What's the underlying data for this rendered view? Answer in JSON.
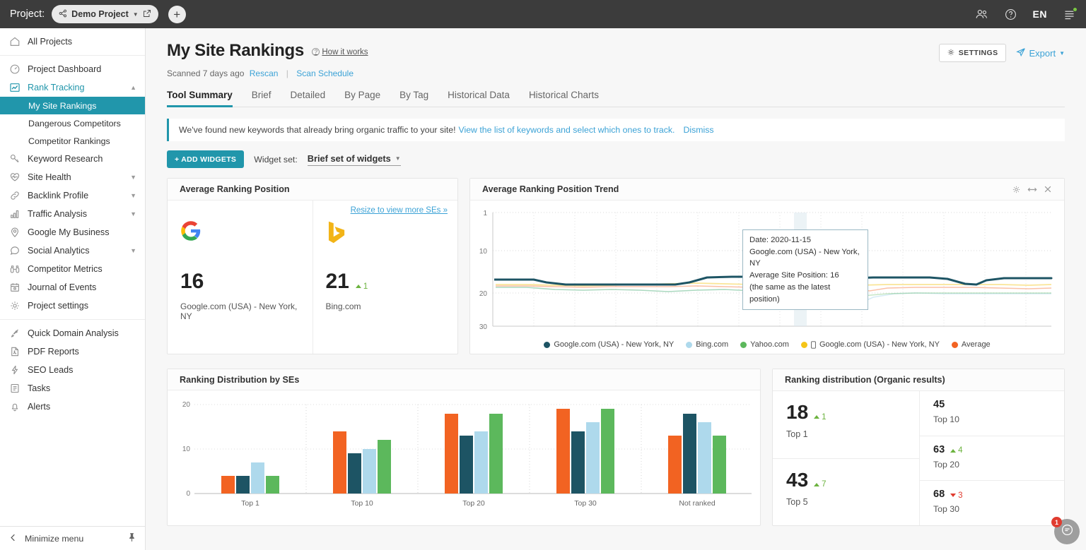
{
  "topbar": {
    "project_label": "Project:",
    "project_name": "Demo Project",
    "add_label": "+",
    "lang": "EN",
    "icons": {
      "users": "users-icon",
      "help": "help-icon",
      "menu": "menu-icon"
    }
  },
  "sidebar": {
    "all_projects": "All Projects",
    "groups": [
      {
        "items": [
          {
            "label": "Project Dashboard",
            "icon": "gauge-icon",
            "chevron": false
          },
          {
            "label": "Rank Tracking",
            "icon": "chart-line-icon",
            "chevron": true,
            "active": true
          }
        ]
      }
    ],
    "subitems": [
      {
        "label": "My Site Rankings",
        "selected": true
      },
      {
        "label": "Dangerous Competitors",
        "selected": false
      },
      {
        "label": "Competitor Rankings",
        "selected": false
      }
    ],
    "items2": [
      {
        "label": "Keyword Research",
        "icon": "key-icon",
        "chevron": false
      },
      {
        "label": "Site Health",
        "icon": "heartbeat-icon",
        "chevron": true
      },
      {
        "label": "Backlink Profile",
        "icon": "link-icon",
        "chevron": true
      },
      {
        "label": "Traffic Analysis",
        "icon": "bars-icon",
        "chevron": true
      },
      {
        "label": "Google My Business",
        "icon": "pin-icon",
        "chevron": false
      },
      {
        "label": "Social Analytics",
        "icon": "chat-icon",
        "chevron": true
      },
      {
        "label": "Competitor Metrics",
        "icon": "binoculars-icon",
        "chevron": false
      },
      {
        "label": "Journal of Events",
        "icon": "calendar-icon",
        "chevron": false
      },
      {
        "label": "Project settings",
        "icon": "gear-icon",
        "chevron": false
      }
    ],
    "items3": [
      {
        "label": "Quick Domain Analysis",
        "icon": "rocket-icon"
      },
      {
        "label": "PDF Reports",
        "icon": "pdf-icon"
      },
      {
        "label": "SEO Leads",
        "icon": "bolt-icon"
      },
      {
        "label": "Tasks",
        "icon": "list-icon"
      },
      {
        "label": "Alerts",
        "icon": "bell-icon"
      }
    ],
    "footer": {
      "label": "Minimize menu",
      "pin": "pin-icon"
    }
  },
  "page": {
    "title": "My Site Rankings",
    "how_it_works": "How it works",
    "settings_label": "SETTINGS",
    "export_label": "Export",
    "scanned": "Scanned 7 days ago",
    "rescan": "Rescan",
    "separator": "|",
    "scan_schedule": "Scan Schedule"
  },
  "tabs": [
    {
      "label": "Tool Summary",
      "active": true
    },
    {
      "label": "Brief",
      "active": false
    },
    {
      "label": "Detailed",
      "active": false
    },
    {
      "label": "By Page",
      "active": false
    },
    {
      "label": "By Tag",
      "active": false
    },
    {
      "label": "Historical Data",
      "active": false
    },
    {
      "label": "Historical Charts",
      "active": false
    }
  ],
  "notice": {
    "text": "We've found new keywords that already bring organic traffic to your site!",
    "link": "View the list of keywords and select which ones to track.",
    "dismiss": "Dismiss"
  },
  "widgetbar": {
    "add_widgets": "+ ADD WIDGETS",
    "widget_set_label": "Widget set:",
    "widget_set_value": "Brief set of widgets"
  },
  "avg_ranking": {
    "title": "Average Ranking Position",
    "resize_link": "Resize to view more SEs »",
    "engines": [
      {
        "logo": "google-logo",
        "value": "16",
        "delta": "",
        "delta_dir": "",
        "label": "Google.com (USA) - New York, NY"
      },
      {
        "logo": "bing-logo",
        "value": "21",
        "delta": "1",
        "delta_dir": "up",
        "label": "Bing.com"
      }
    ]
  },
  "trend": {
    "title": "Average Ranking Position Trend",
    "tools": [
      "gear-icon",
      "resize-icon",
      "close-icon"
    ],
    "tooltip": {
      "date": "Date: 2020-11-15",
      "engine": "Google.com (USA) - New York, NY",
      "position": "Average Site Position: 16",
      "note": "(the same as the latest position)"
    }
  },
  "dist": {
    "title": "Ranking Distribution by SEs"
  },
  "org_dist": {
    "title": "Ranking distribution (Organic results)",
    "big": [
      {
        "value": "18",
        "delta": "1",
        "delta_dir": "up",
        "label": "Top 1"
      },
      {
        "value": "43",
        "delta": "7",
        "delta_dir": "up",
        "label": "Top 5"
      }
    ],
    "rows": [
      {
        "value": "45",
        "delta": "",
        "delta_dir": "",
        "label": "Top 10"
      },
      {
        "value": "63",
        "delta": "4",
        "delta_dir": "up",
        "label": "Top 20"
      },
      {
        "value": "68",
        "delta": "3",
        "delta_dir": "down",
        "label": "Top 30"
      }
    ]
  },
  "fab": {
    "badge": "1",
    "icon": "chat-icon"
  },
  "colors": {
    "accent": "#2196ab",
    "link": "#3ba2d6",
    "topbar": "#3c3c3c",
    "up": "#6cb33f",
    "down": "#e03b2f",
    "series_google": "#1d5464",
    "series_bing": "#aed9ec",
    "series_yahoo": "#5cb85c",
    "series_mobile": "#f5c518",
    "series_average": "#f26322"
  },
  "chart_data": [
    {
      "type": "line",
      "title": "Average Ranking Position Trend",
      "xlabel": "",
      "ylabel": "",
      "ylim": [
        1,
        30
      ],
      "yticks": [
        1,
        10,
        20,
        30
      ],
      "y_inverted": true,
      "grid": true,
      "legend_position": "bottom",
      "legend": [
        {
          "name": "Google.com (USA) - New York, NY",
          "color": "#1d5464"
        },
        {
          "name": "Bing.com",
          "color": "#aed9ec"
        },
        {
          "name": "Yahoo.com",
          "color": "#5cb85c"
        },
        {
          "name": "Google.com (USA) - New York, NY",
          "color": "#f5c518",
          "mobile": true
        },
        {
          "name": "Average",
          "color": "#f26322"
        }
      ],
      "series": [
        {
          "name": "Google.com (USA) - New York, NY",
          "color": "#1d5464",
          "values": [
            16,
            16,
            16,
            16,
            16.5,
            17,
            17,
            17,
            17,
            17,
            17,
            17,
            17,
            17,
            17,
            17,
            16.5,
            15.5,
            15,
            15,
            15,
            15,
            15,
            15.5,
            16,
            16,
            16,
            16,
            16,
            16,
            16,
            16,
            15.8,
            15.5,
            15.5,
            15.5,
            15.5,
            16,
            16.2,
            15.8,
            15.5,
            15.5,
            15.5,
            15.5,
            15.5,
            15.5,
            15.5,
            15.8,
            16.3,
            17,
            16.2,
            15.8,
            15.8,
            15.8,
            15.8
          ]
        },
        {
          "name": "Bing.com",
          "color": "#aed9ec",
          "values": [
            17.5,
            17.5,
            17.8,
            18,
            18,
            18.2,
            18,
            18,
            18,
            18,
            18.5,
            19,
            18.8,
            18.2,
            18,
            18.3,
            18.5,
            18.6,
            18.4,
            18.2,
            18.5,
            19,
            19.2,
            18.8,
            18.3,
            18.3,
            18.3,
            18.5,
            19,
            19.5,
            20,
            21,
            22,
            21,
            20,
            19.5,
            19.3,
            19.3,
            19.3,
            19.3,
            19.3,
            19.4,
            19.5,
            19.6,
            19.7,
            19.8,
            19.8,
            19.8,
            19.8,
            19.8,
            19.8,
            19.5,
            19.3,
            19.3,
            19.3
          ]
        },
        {
          "name": "Yahoo.com",
          "color": "#5cb85c",
          "values": [
            17.5,
            17.5,
            17.8,
            18,
            18,
            18.2,
            18,
            18,
            18,
            18,
            18.5,
            19,
            18.8,
            18.2,
            18,
            18.3,
            18.5,
            18.6,
            18.4,
            18.2,
            18.5,
            19,
            19.2,
            18.8,
            18.3,
            18.3,
            18.3,
            18.5,
            19,
            19.3,
            19.5,
            19.8,
            19.8,
            19.6,
            19.4,
            19.2,
            19.2,
            19.2,
            19.2,
            19.2,
            19.2,
            19.3,
            19.4,
            19.4,
            19.4,
            19.4,
            19.4,
            19.4,
            19.4,
            19.4,
            19.4,
            19.3,
            19.3,
            19.3,
            19.3
          ]
        },
        {
          "name": "Google.com (USA) - New York, NY mobile",
          "color": "#f5c518",
          "values": [
            17,
            17,
            17,
            17.2,
            17.5,
            17.6,
            17.5,
            17.4,
            17.4,
            17.4,
            17.6,
            18,
            18,
            17.6,
            17.4,
            17.5,
            17.5,
            17.2,
            17,
            16.8,
            17,
            17.2,
            17.4,
            17.2,
            16.9,
            16.8,
            16.8,
            16.9,
            17,
            17.2,
            17.3,
            17.4,
            17.5,
            17.4,
            17.3,
            17.2,
            17.2,
            17.2,
            17.2,
            17.2,
            17.2,
            17.3,
            17.4,
            17.4,
            17.4,
            17.4,
            17.4,
            17.4,
            17.4,
            17.5,
            17.6,
            17.5,
            17.4,
            17.4,
            17.4
          ]
        },
        {
          "name": "Average",
          "color": "#f26322",
          "values": [
            17.2,
            17.2,
            17.4,
            17.6,
            17.7,
            17.8,
            17.7,
            17.6,
            17.6,
            17.6,
            17.8,
            18.2,
            18.1,
            17.8,
            17.6,
            17.8,
            17.9,
            17.8,
            17.6,
            17.5,
            17.7,
            18,
            18.1,
            17.9,
            17.6,
            17.6,
            17.6,
            17.7,
            17.9,
            18,
            18.1,
            18.2,
            18.4,
            18.9,
            18.6,
            18.2,
            18.1,
            18.1,
            18.1,
            18.1,
            18.1,
            18.1,
            18.2,
            18.2,
            18.2,
            18.2,
            18.2,
            18.2,
            18.2,
            18.3,
            18.4,
            18.3,
            18.2,
            18.2,
            18.2
          ]
        }
      ],
      "highlight_point": {
        "x_label": "2020-11-15",
        "series": "Google.com (USA) - New York, NY",
        "value": 16
      }
    },
    {
      "type": "bar",
      "title": "Ranking Distribution by SEs",
      "categories": [
        "Top 1",
        "Top 10",
        "Top 20",
        "Top 30",
        "Not ranked"
      ],
      "xlabel": "",
      "ylabel": "",
      "ylim": [
        0,
        20
      ],
      "yticks": [
        0,
        10,
        20
      ],
      "grid": true,
      "series": [
        {
          "name": "Average",
          "color": "#f26322",
          "values": [
            4,
            14,
            18,
            19,
            13
          ]
        },
        {
          "name": "Google.com (USA) - New York, NY",
          "color": "#1d5464",
          "values": [
            4,
            9,
            13,
            14,
            18
          ]
        },
        {
          "name": "Bing.com",
          "color": "#aed9ec",
          "values": [
            7,
            10,
            14,
            16,
            16
          ]
        },
        {
          "name": "Yahoo.com",
          "color": "#5cb85c",
          "values": [
            4,
            12,
            18,
            19,
            13
          ]
        }
      ]
    },
    {
      "type": "table",
      "title": "Ranking distribution (Organic results)",
      "categories": [
        "Top 1",
        "Top 5",
        "Top 10",
        "Top 20",
        "Top 30"
      ],
      "values": [
        18,
        43,
        45,
        63,
        68
      ],
      "deltas": [
        1,
        7,
        null,
        4,
        -3
      ]
    }
  ]
}
